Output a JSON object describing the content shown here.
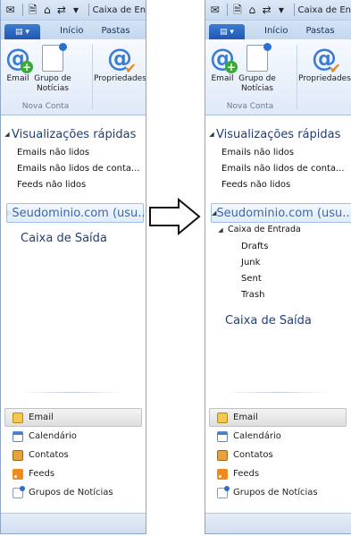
{
  "window": {
    "title": "Caixa de En"
  },
  "ribbon": {
    "file_tab": "▤ ▾",
    "tabs": [
      "Início",
      "Pastas"
    ],
    "buttons": {
      "email": "Email",
      "newsgroup_line1": "Grupo de",
      "newsgroup_line2": "Notícias",
      "properties": "Propriedades"
    },
    "group_label": "Nova Conta"
  },
  "quick_views": {
    "heading": "Visualizações rápidas",
    "items": [
      "Emails não lidos",
      "Emails não lidos de conta...",
      "Feeds não lidos"
    ]
  },
  "account": {
    "left_label": "Seudominio.com (usu...",
    "right_label": "Seudominio.com (usu...",
    "inbox": "Caixa de Entrada",
    "subfolders": [
      "Drafts",
      "Junk",
      "Sent",
      "Trash"
    ]
  },
  "outbox": "Caixa de Saída",
  "bottom_nav": [
    "Email",
    "Calendário",
    "Contatos",
    "Feeds",
    "Grupos de Notícias"
  ],
  "colors": {
    "heading": "#1e3f78",
    "accent": "#3a7bd5",
    "border": "#8fa6c4"
  },
  "icons": {
    "arrow": "right-arrow-outline-icon"
  }
}
